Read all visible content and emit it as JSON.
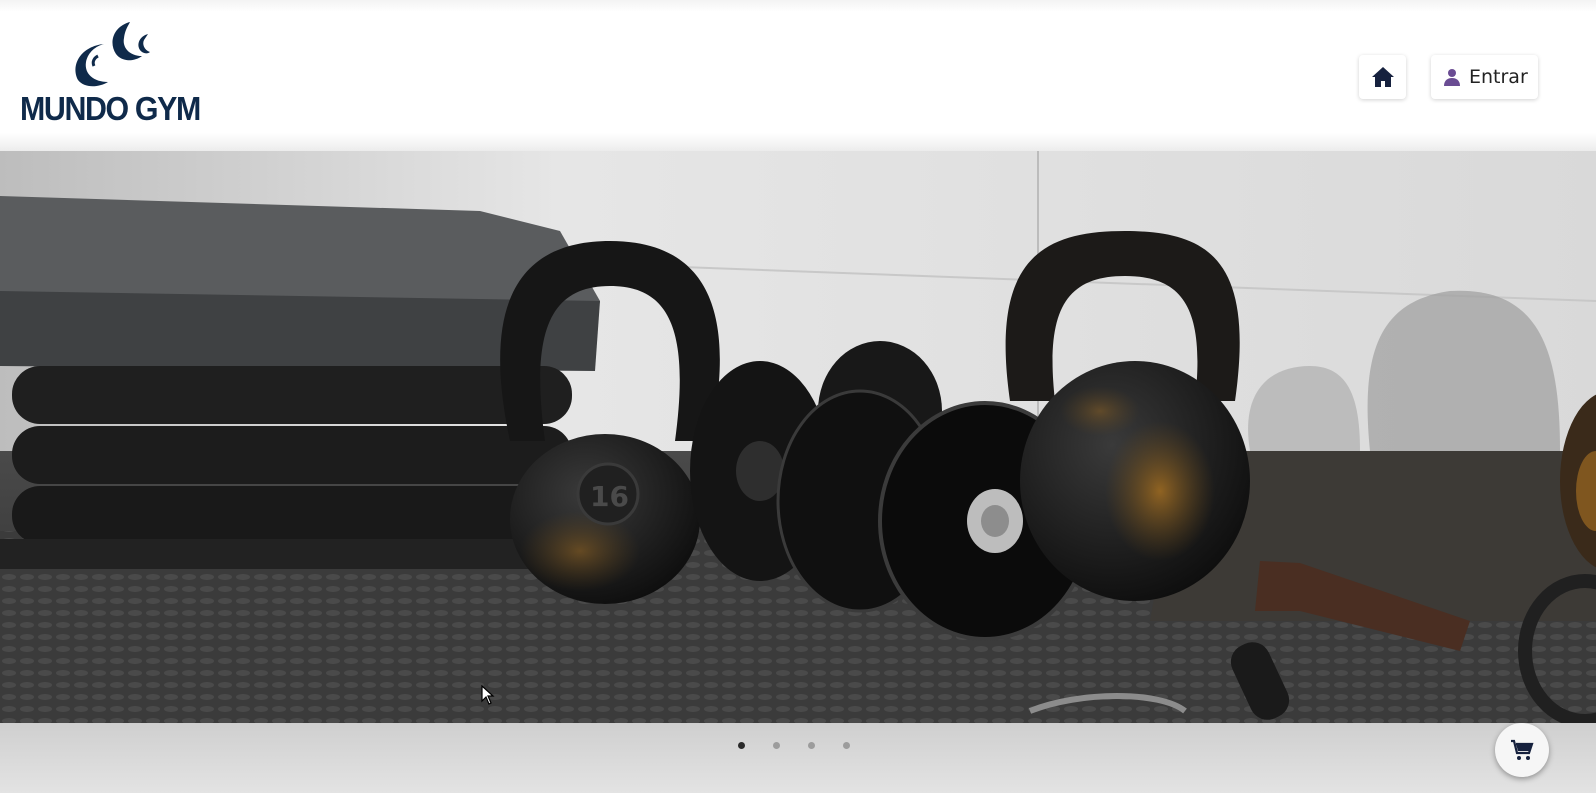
{
  "brand": {
    "name": "MUNDO GYM",
    "color": "#0f2a4a"
  },
  "nav": {
    "home_icon": "home-icon",
    "login_icon": "user-icon",
    "login_label": "Entrar",
    "login_icon_color": "#6a4c93"
  },
  "carousel": {
    "slide_count": 4,
    "active_index": 0,
    "slide_subject": "gym kettlebells and dumbbells photo"
  },
  "cart": {
    "icon": "cart-icon"
  },
  "kettlebell_weight": "16"
}
